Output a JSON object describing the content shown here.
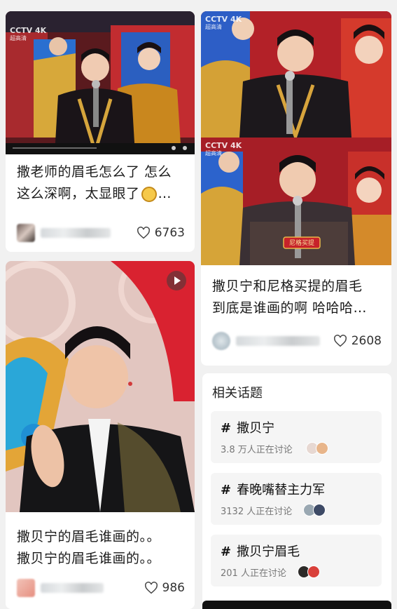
{
  "posts": [
    {
      "title_line1": "撒老师的眉毛怎么了 怎么",
      "title_line2": "这么深啊，太显眼了",
      "likes": "6763",
      "overlay_logo": "CCTV 4K",
      "overlay_sub": "超高清"
    },
    {
      "title_line1": "撒贝宁和尼格买提的眉毛",
      "title_line2": "到底是谁画的啊 哈哈哈…",
      "likes": "2608",
      "overlay_logo": "CCTV 4K",
      "overlay_sub": "超高清",
      "badge": "尼格买提"
    },
    {
      "title_line1": "撒贝宁的眉毛谁画的。。",
      "title_line2": "撒贝宁的眉毛谁画的。。",
      "likes": "986"
    }
  ],
  "topics": {
    "heading": "相关话题",
    "items": [
      {
        "name": "撒贝宁",
        "discussing": "3.8 万人正在讨论"
      },
      {
        "name": "春晚嘴替主力军",
        "discussing": "3132 人正在讨论"
      },
      {
        "name": "撒贝宁眉毛",
        "discussing": "201 人正在讨论"
      }
    ]
  },
  "icons": [
    "heart-outline-icon",
    "play-icon",
    "hashtag-icon",
    "emoji-face-icon"
  ],
  "colors": {
    "background": "#f1f1f1",
    "card": "#ffffff",
    "stage_red": "#b8202a",
    "stage_gold": "#d9a93a",
    "topic_bg": "#f5f5f5"
  }
}
